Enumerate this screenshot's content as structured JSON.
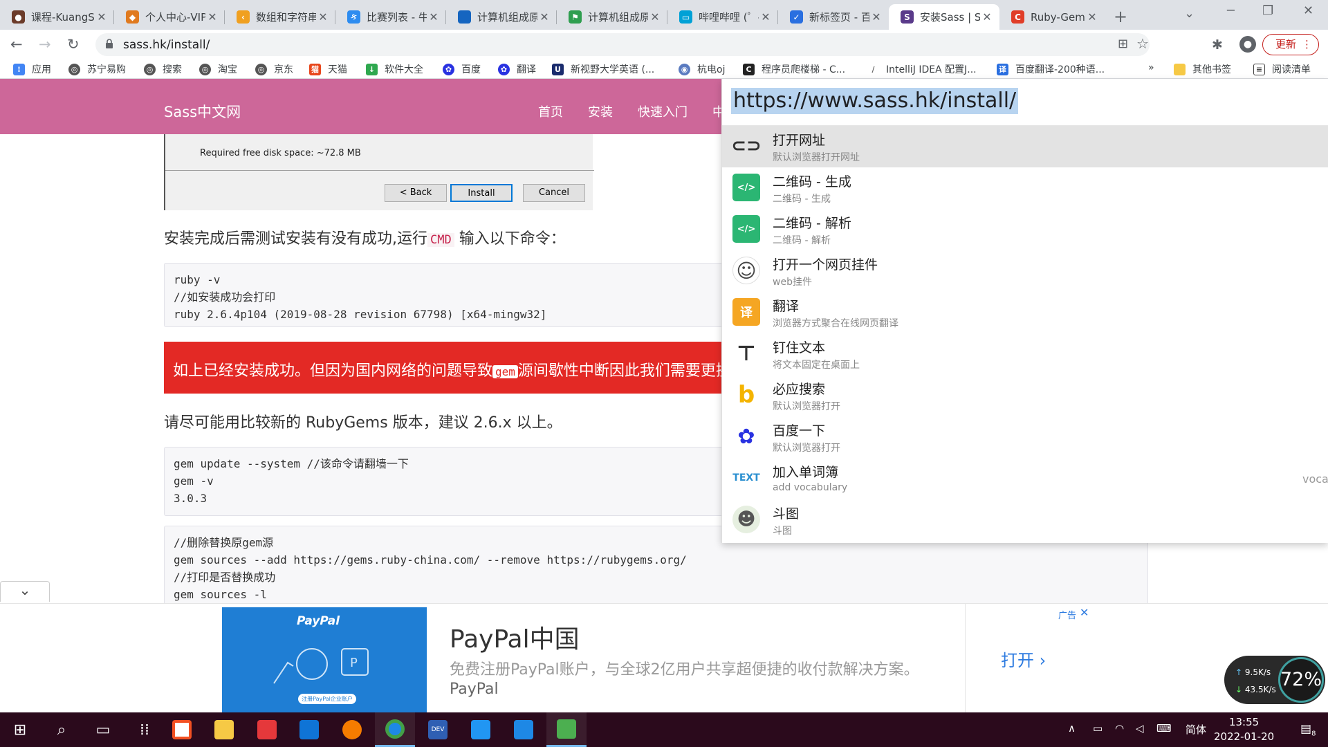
{
  "tabs": [
    {
      "title": "课程-KuangStudy",
      "icon": "fox-avatar-icon",
      "color": "#6b3b2a"
    },
    {
      "title": "个人中心-VIP",
      "icon": "lion-icon",
      "color": "#e07a1f"
    },
    {
      "title": "数组和字符串",
      "icon": "leetcode-icon",
      "color": "#f0a020"
    },
    {
      "title": "比赛列表 - 牛客",
      "icon": "kedou-icon",
      "color": "#2d8cf0"
    },
    {
      "title": "计算机组成原理",
      "icon": "blue-square-icon",
      "color": "#1565c0"
    },
    {
      "title": "计算机组成原理",
      "icon": "green-flag-icon",
      "color": "#2e9e4f"
    },
    {
      "title": "哔哩哔哩 (゜-゜)",
      "icon": "bilibili-icon",
      "color": "#00a1d6"
    },
    {
      "title": "新标签页 - 百度",
      "icon": "check-logo-icon",
      "color": "#2a6fe0"
    },
    {
      "title": "安装Sass | Sass中文网",
      "icon": "sass-s-icon",
      "color": "#5a3a8a"
    },
    {
      "title": "Ruby-Gems",
      "icon": "csdn-c-icon",
      "color": "#e03d28"
    }
  ],
  "address": {
    "url": "sass.hk/install/"
  },
  "toolbar": {
    "update_label": "更新"
  },
  "bookmarks": [
    {
      "label": "应用",
      "icon": "apps-grid-icon",
      "color": "#4285f4"
    },
    {
      "label": "苏宁易购",
      "icon": "globe-icon",
      "color": "#555555"
    },
    {
      "label": "搜索",
      "icon": "globe-icon",
      "color": "#555555"
    },
    {
      "label": "淘宝",
      "icon": "globe-icon",
      "color": "#555555"
    },
    {
      "label": "京东",
      "icon": "globe-icon",
      "color": "#555555"
    },
    {
      "label": "天猫",
      "icon": "tmall-icon",
      "color": "#e8471c"
    },
    {
      "label": "软件大全",
      "icon": "download-icon",
      "color": "#2fa84f"
    },
    {
      "label": "百度",
      "icon": "baidu-paw-icon",
      "color": "#2932e1"
    },
    {
      "label": "翻译",
      "icon": "baidu-paw-icon",
      "color": "#2932e1"
    },
    {
      "label": "新视野大学英语 (...",
      "icon": "u-icon",
      "color": "#1a2b6d"
    },
    {
      "label": "杭电oj",
      "icon": "hdu-icon",
      "color": "#5a7bc0"
    },
    {
      "label": "程序员爬楼梯 - C...",
      "icon": "dark-c-icon",
      "color": "#222222"
    },
    {
      "label": "IntelliJ IDEA 配置J...",
      "icon": "feather-icon",
      "color": "#666666"
    },
    {
      "label": "百度翻译-200种语...",
      "icon": "translate-icon",
      "color": "#2a6fe0"
    }
  ],
  "bookmarks_more": "»",
  "bookmarks_other": "其他书签",
  "bookmarks_reading": "阅读清单",
  "site": {
    "logo": "Sass中文网",
    "nav": [
      "首页",
      "安装",
      "快速入门",
      "中"
    ]
  },
  "installer": {
    "required": "Required free disk space: ~72.8 MB",
    "back": "< Back",
    "install": "Install",
    "cancel": "Cancel"
  },
  "content": {
    "p1_before": "安装完成后需测试安装有没有成功,运行",
    "p1_cmd": "CMD",
    "p1_after": " 输入以下命令：",
    "code1": [
      "ruby -v",
      "//如安装成功会打印",
      "ruby 2.6.4p104 (2019-08-28 revision 67798) [x64-mingw32]"
    ],
    "alert_before": "如上已经安装成功。但因为国内网络的问题导致",
    "alert_gem": "gem",
    "alert_after": "源间歇性中断因此我们需要更换gem源",
    "p2": "请尽可能用比较新的 RubyGems 版本，建议 2.6.x 以上。",
    "code2": [
      "gem update --system //该命令请翻墙一下",
      "gem -v",
      "3.0.3"
    ],
    "code3": [
      "//删除替换原gem源",
      "gem sources --add https://gems.ruby-china.com/ --remove https://rubygems.org/",
      "//打印是否替换成功",
      "gem sources -l"
    ]
  },
  "launcher": {
    "input": "https://www.sass.hk/install/",
    "items": [
      {
        "title": "打开网址",
        "sub": "默认浏览器打开网址",
        "icon": "link-icon",
        "color": "#eeeeee"
      },
      {
        "title": "二维码 - 生成",
        "sub": "二维码 - 生成",
        "icon": "qrcode-icon",
        "color": "#2bb673"
      },
      {
        "title": "二维码 - 解析",
        "sub": "二维码 - 解析",
        "icon": "qrcode-icon",
        "color": "#2bb673"
      },
      {
        "title": "打开一个网页挂件",
        "sub": "web挂件",
        "icon": "ghost-icon",
        "color": "#ffffff"
      },
      {
        "title": "翻译",
        "sub": "浏览器方式聚合在线网页翻译",
        "icon": "translate-icon",
        "color": "#f5a623"
      },
      {
        "title": "钉住文本",
        "sub": "将文本固定在桌面上",
        "icon": "pin-icon",
        "color": "#ffffff"
      },
      {
        "title": "必应搜索",
        "sub": "默认浏览器打开",
        "icon": "bing-icon",
        "color": "#ffffff"
      },
      {
        "title": "百度一下",
        "sub": "默认浏览器打开",
        "icon": "baidu-paw-icon",
        "color": "#ffffff"
      },
      {
        "title": "加入单词簿",
        "sub": "add vocabulary",
        "icon": "text-icon",
        "color": "#ffffff"
      },
      {
        "title": "斗图",
        "sub": "斗图",
        "icon": "face-icon",
        "color": "#ffffff"
      }
    ],
    "side_text": "voca"
  },
  "ad": {
    "brand_logo": "PayPal",
    "register": "注册PayPal企业账户",
    "title": "PayPal中国",
    "desc": "免费注册PayPal账户，与全球2亿用户共享超便捷的收付款解决方案。",
    "brand": "PayPal",
    "open": "打开",
    "tag": "广告",
    "close": "✕"
  },
  "netspeed": {
    "up": "9.5K/s",
    "down": "43.5K/s",
    "percent": "72%"
  },
  "taskbar": {
    "apps": [
      {
        "name": "start-icon"
      },
      {
        "name": "search-icon"
      },
      {
        "name": "task-view-icon"
      },
      {
        "name": "apps-grid-icon"
      },
      {
        "name": "store-icon"
      },
      {
        "name": "file-explorer-icon"
      },
      {
        "name": "gift-icon"
      },
      {
        "name": "mail-icon"
      },
      {
        "name": "orange-app-icon"
      },
      {
        "name": "chrome-icon"
      },
      {
        "name": "devcpp-icon"
      },
      {
        "name": "feishu-icon"
      },
      {
        "name": "vscode-icon"
      },
      {
        "name": "green-app-icon"
      }
    ],
    "ime": "简体",
    "time": "13:55",
    "date": "2022-01-20",
    "notif_count": "8"
  }
}
